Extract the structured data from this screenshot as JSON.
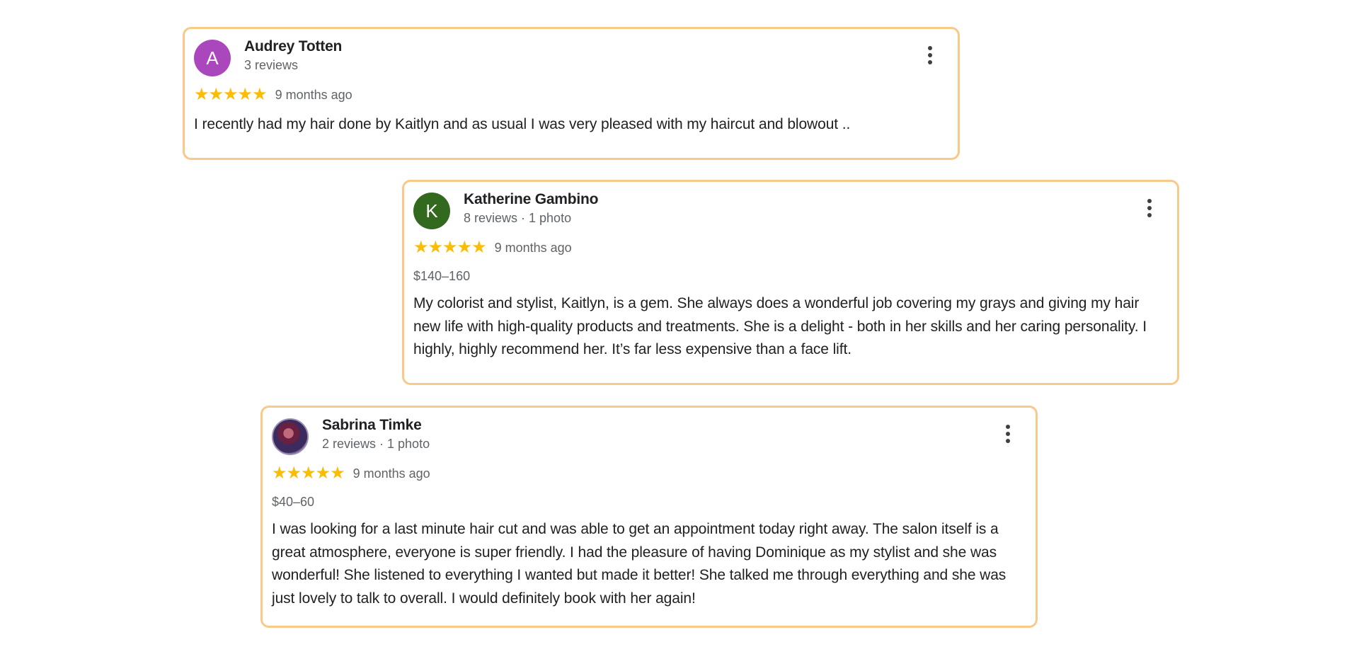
{
  "accent_border_color": "#f9c98a",
  "star_color": "#fbbc04",
  "reviews": [
    {
      "avatar_letter": "A",
      "avatar_color": "#ab47bc",
      "name": "Audrey Totten",
      "meta": "3 reviews",
      "stars": "★★★★★",
      "rating": 5,
      "date": "9 months ago",
      "price": "",
      "text": "I recently had my hair done by Kaitlyn and as usual I was very pleased with my haircut and blowout .."
    },
    {
      "avatar_letter": "K",
      "avatar_color": "#33691e",
      "name": "Katherine Gambino",
      "meta": "8 reviews · 1 photo",
      "stars": "★★★★★",
      "rating": 5,
      "date": "9 months ago",
      "price": "$140–160",
      "text": "My colorist and stylist, Kaitlyn, is a gem. She always does a wonderful job covering my grays and giving my hair new life with high-quality products and treatments. She is a delight - both in her skills and her caring personality. I highly, highly recommend her. It’s far less expensive than a face lift."
    },
    {
      "avatar_letter": "",
      "avatar_color": "",
      "name": "Sabrina Timke",
      "meta": "2 reviews · 1 photo",
      "stars": "★★★★★",
      "rating": 5,
      "date": "9 months ago",
      "price": "$40–60",
      "text": "I was looking for a last minute hair cut and was able to get an appointment today right away. The salon itself is a great atmosphere, everyone is super friendly. I had the pleasure of having Dominique as my stylist and she was wonderful! She listened to everything I wanted but made it better! She talked me through everything and she was just lovely to talk to overall. I would definitely book with her again!"
    }
  ]
}
